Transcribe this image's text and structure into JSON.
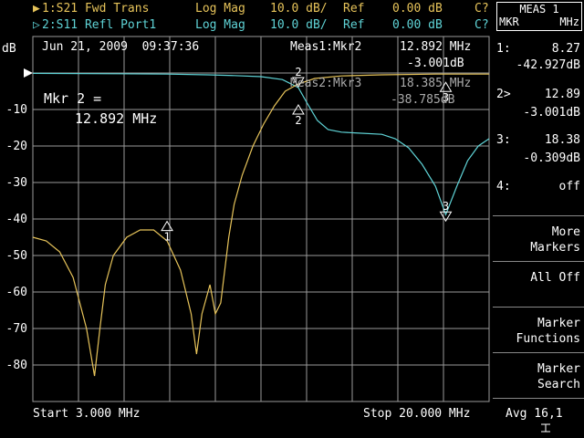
{
  "header": {
    "trace1": {
      "marker": "▶",
      "name": "1:S21 Fwd Trans",
      "format": "Log Mag",
      "scale": "10.0 dB/",
      "ref_label": "Ref",
      "ref_value": "0.00 dB",
      "status": "C?"
    },
    "trace2": {
      "marker": "▷",
      "name": "2:S11 Refl Port1",
      "format": "Log Mag",
      "scale": "10.0 dB/",
      "ref_label": "Ref",
      "ref_value": "0.00 dB",
      "status": "C?"
    }
  },
  "plot": {
    "y_unit": "dB",
    "y_ticks": [
      "-10",
      "-20",
      "-30",
      "-40",
      "-50",
      "-60",
      "-70",
      "-80"
    ],
    "date": "Jun 21, 2009  09:37:36",
    "marker_note_line1": "Mkr 2 =",
    "marker_note_line2": "12.892 MHz",
    "meas1_label": "Meas1:Mkr2",
    "meas1_freq": "12.892 MHz",
    "meas1_value": "-3.001dB",
    "meas2_label": "Meas2:Mkr3",
    "meas2_freq": "18.385 MHz",
    "meas2_value": "-38.785dB",
    "start": "Start 3.000 MHz",
    "stop": "Stop 20.000 MHz",
    "marker_labels": {
      "m1": "1",
      "m2a": "2",
      "m2b": "2",
      "m3a": "3",
      "m3b": "3"
    },
    "colors": {
      "trace1": "#e6c35a",
      "trace2": "#5fd3d6",
      "grid": "#9a9a9a"
    }
  },
  "chart_data": {
    "type": "line",
    "xlabel": "",
    "ylabel": "dB",
    "xlim": [
      3.0,
      20.0
    ],
    "ylim": [
      -90,
      10
    ],
    "series": [
      {
        "name": "1:S21 Fwd Trans",
        "x": [
          3.0,
          3.5,
          4.0,
          4.5,
          5.0,
          5.3,
          5.5,
          5.7,
          6.0,
          6.5,
          7.0,
          7.5,
          8.0,
          8.5,
          8.9,
          9.1,
          9.3,
          9.6,
          9.8,
          10.0,
          10.3,
          10.5,
          10.8,
          11.2,
          11.6,
          12.0,
          12.4,
          12.892,
          13.5,
          14.5,
          16.0,
          18.0,
          20.0
        ],
        "values": [
          -45,
          -46,
          -49,
          -56,
          -70,
          -83,
          -70,
          -58,
          -50,
          -45,
          -43,
          -43,
          -46,
          -54,
          -66,
          -77,
          -66,
          -58,
          -66,
          -63,
          -45,
          -36,
          -28,
          -20,
          -14,
          -9,
          -5,
          -3,
          -1.5,
          -0.8,
          -0.5,
          -0.3,
          -0.3
        ]
      },
      {
        "name": "2:S11 Refl Port1",
        "x": [
          3.0,
          6.0,
          8.0,
          9.5,
          10.5,
          11.5,
          12.3,
          12.892,
          13.2,
          13.6,
          14.0,
          14.5,
          15.0,
          16.0,
          16.5,
          17.0,
          17.5,
          18.0,
          18.385,
          18.8,
          19.2,
          19.6,
          20.0
        ],
        "values": [
          -0.1,
          -0.2,
          -0.3,
          -0.5,
          -0.7,
          -1.0,
          -1.8,
          -4.0,
          -8.0,
          -13.0,
          -15.5,
          -16.2,
          -16.4,
          -16.8,
          -18.0,
          -20.5,
          -25.0,
          -31.0,
          -38.8,
          -31.0,
          -24.0,
          -20.0,
          -18.0
        ]
      }
    ],
    "markers": [
      {
        "id": "1",
        "x": 8.0,
        "y": -42.9
      },
      {
        "id": "2",
        "x": 12.892,
        "y": -3.001
      },
      {
        "id": "3",
        "x": 18.385,
        "y": -0.309
      }
    ]
  },
  "panel": {
    "title": "MEAS 1",
    "mkr_label": "MKR",
    "unit_label": "MHz",
    "markers": [
      {
        "id": "1:",
        "freq": "8.27",
        "value": "-42.927dB"
      },
      {
        "id": "2>",
        "freq": "12.89",
        "value": "-3.001dB"
      },
      {
        "id": "3:",
        "freq": "18.38",
        "value": "-0.309dB"
      },
      {
        "id": "4:",
        "freq": "off",
        "value": ""
      }
    ],
    "softkeys": [
      {
        "line1": "More",
        "line2": "Markers"
      },
      {
        "line1": "All Off",
        "line2": ""
      },
      {
        "line1": "Marker",
        "line2": "Functions"
      },
      {
        "line1": "Marker",
        "line2": "Search"
      }
    ],
    "avg": "Avg 16,1"
  }
}
